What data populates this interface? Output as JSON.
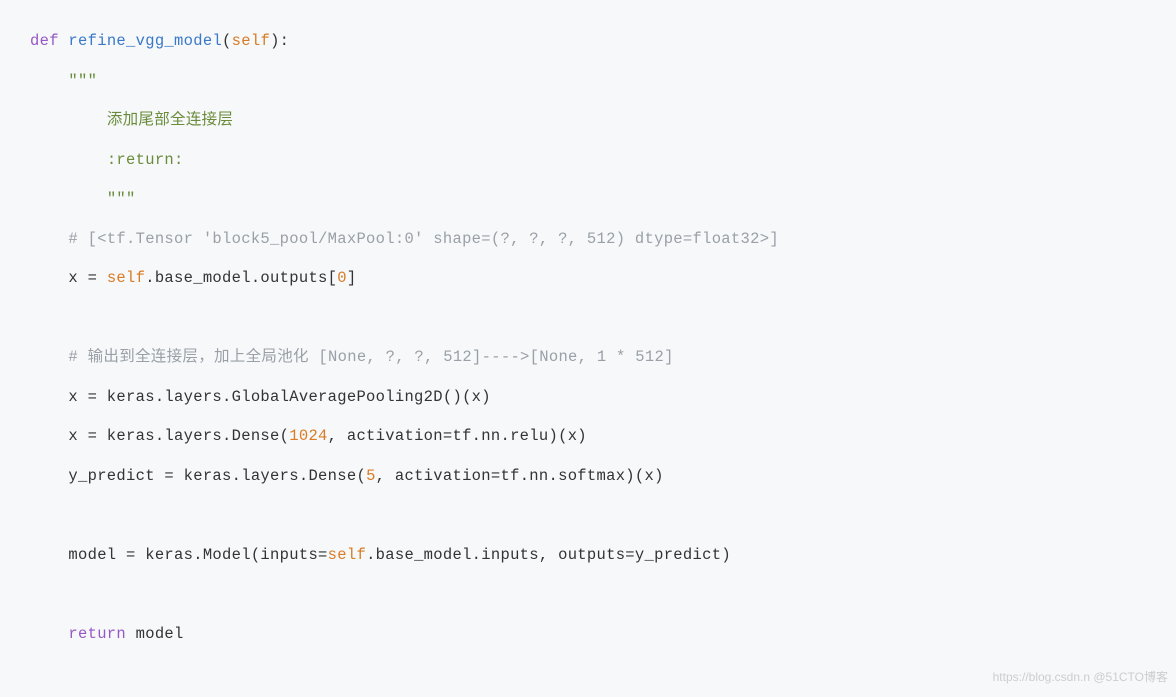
{
  "code": {
    "l1_def": "def",
    "l1_fn": "refine_vgg_model",
    "l1_self": "self",
    "l2_tripquote": "\"\"\"",
    "l3_doc": "添加尾部全连接层",
    "l4_return": ":return:",
    "l5_tripquote": "\"\"\"",
    "l6_comment": "# [<tf.Tensor 'block5_pool/MaxPool:0' shape=(?, ?, ?, 512) dtype=float32>]",
    "l7_code_a": "x = ",
    "l7_self": "self",
    "l7_code_b": ".base_model.outputs[",
    "l7_num": "0",
    "l7_code_c": "]",
    "l8_comment": "# 输出到全连接层，加上全局池化 [None, ?, ?, 512]---->[None, 1 * 512]",
    "l9_code": "x = keras.layers.GlobalAveragePooling2D()(x)",
    "l10_code_a": "x = keras.layers.Dense(",
    "l10_num": "1024",
    "l10_code_b": ", activation=tf.nn.relu)(x)",
    "l11_code_a": "y_predict = keras.layers.Dense(",
    "l11_num": "5",
    "l11_code_b": ", activation=tf.nn.softmax)(x)",
    "l12_code_a": "model = keras.Model(inputs=",
    "l12_self": "self",
    "l12_code_b": ".base_model.inputs, outputs=y_predict)",
    "l13_return": "return",
    "l13_model": " model"
  },
  "watermark": "https://blog.csdn.n @51CTO博客"
}
